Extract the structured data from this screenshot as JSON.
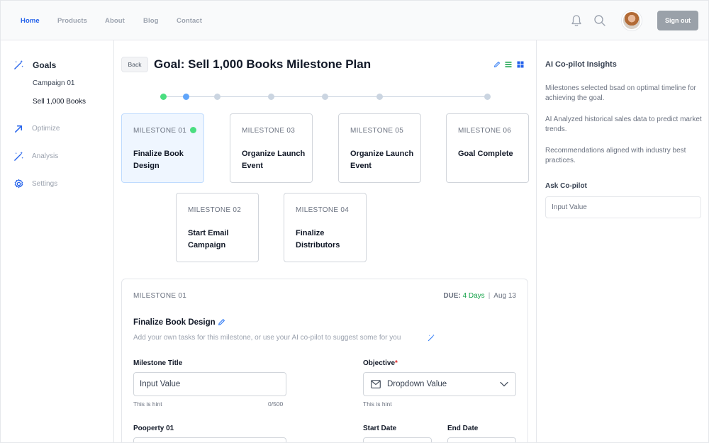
{
  "nav": {
    "links": [
      "Home",
      "Products",
      "About",
      "Blog",
      "Contact"
    ],
    "active": "Home",
    "sign_out": "Sign out"
  },
  "sidebar": {
    "goals_label": "Goals",
    "sub_items": [
      "Campaign 01",
      "Sell 1,000 Books"
    ],
    "items": [
      "Optimize",
      "Analysis",
      "Settings"
    ]
  },
  "header": {
    "back_label": "Back",
    "title": "Goal: Sell 1,000 Books Milestone Plan"
  },
  "milestones": [
    {
      "num": "MILESTONE 01",
      "title": "Finalize Book Design"
    },
    {
      "num": "MILESTONE 03",
      "title": "Organize Launch Event"
    },
    {
      "num": "MILESTONE 05",
      "title": "Organize Launch Event"
    },
    {
      "num": "MILESTONE 06",
      "title": "Goal Complete"
    },
    {
      "num": "MILESTONE 02",
      "title": "Start Email Campaign"
    },
    {
      "num": "MILESTONE 04",
      "title": "Finalize Distributors"
    }
  ],
  "detail": {
    "label": "MILESTONE 01",
    "due_label": "DUE:",
    "due_days": "4 Days",
    "due_date": "Aug 13",
    "title": "Finalize Book Design",
    "description": "Add your own tasks for this milestone, or use your AI co-pilot to suggest some for you",
    "milestone_title_label": "Milestone Title",
    "milestone_title_value": "Input Value",
    "milestone_title_hint": "This is hint",
    "milestone_title_count": "0/500",
    "objective_label": "Objective",
    "objective_required": "*",
    "objective_value": "Dropdown Value",
    "objective_hint": "This is hint",
    "property_label": "Pooperty 01",
    "start_date_label": "Start Date",
    "end_date_label": "End Date"
  },
  "insights": {
    "title": "AI Co-pilot Insights",
    "paragraphs": [
      "Milestones selected bsad on optimal timeline for achieving the goal.",
      "AI Analyzed historical sales data to predict market trends.",
      "Recommendations aligned with industry best practices."
    ],
    "ask_label": "Ask Co-pilot",
    "ask_placeholder": "Input Value"
  },
  "colors": {
    "accent": "#2563eb",
    "success": "#16a34a",
    "timeline_done": "#4ade80",
    "timeline_current": "#60a5fa"
  }
}
